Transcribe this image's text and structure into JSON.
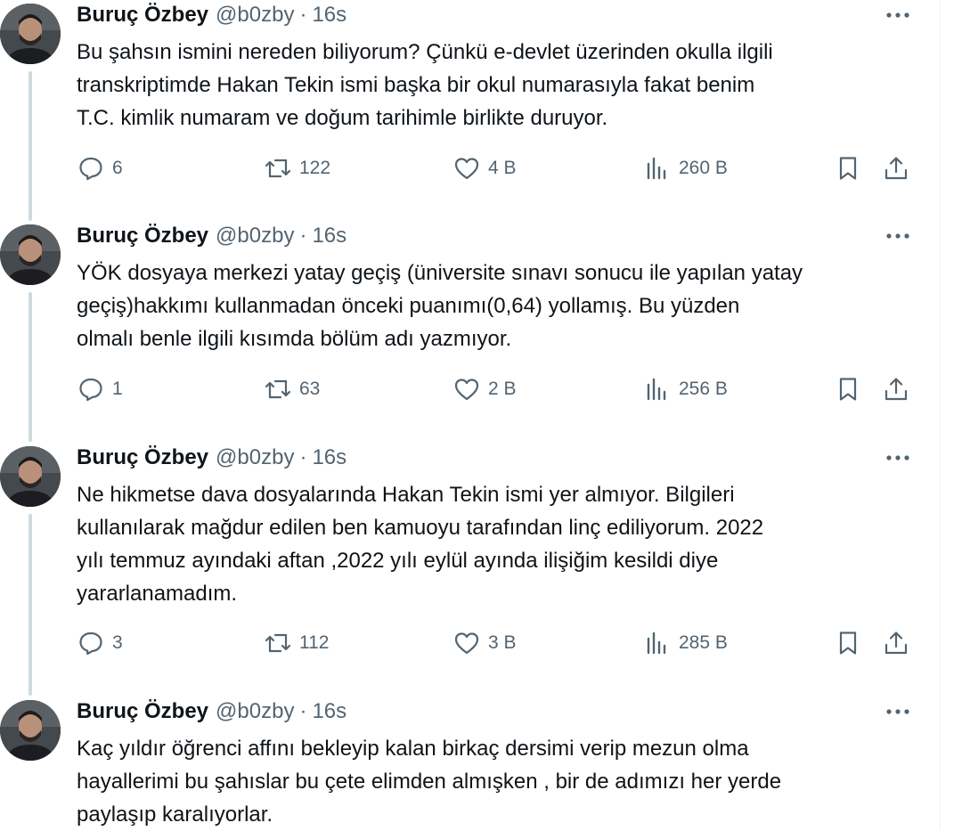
{
  "author": {
    "display_name": "Buruç Özbey",
    "handle": "@b0zby",
    "separator": "·",
    "time": "16s"
  },
  "icons": {
    "more": "more-horizontal-icon",
    "reply": "reply-icon",
    "retweet": "retweet-icon",
    "like": "heart-icon",
    "views": "views-icon",
    "bookmark": "bookmark-icon",
    "share": "share-icon"
  },
  "colors": {
    "text": "#0f1419",
    "secondary": "#536471",
    "thread_line": "#cfd9de"
  },
  "tweets": [
    {
      "text": "Bu şahsın ismini nereden biliyorum? Çünkü e-devlet üzerinden okulla ilgili\ntranskriptimde Hakan Tekin ismi başka bir okul numarasıyla fakat benim\nT.C. kimlik numaram ve doğum tarihimle birlikte duruyor.",
      "replies": "6",
      "retweets": "122",
      "likes": "4 B",
      "views": "260 B"
    },
    {
      "text": "YÖK dosyaya merkezi yatay geçiş  (üniversite sınavı sonucu ile yapılan yatay\ngeçiş)hakkımı kullanmadan önceki puanımı(0,64) yollamış. Bu yüzden\nolmalı benle ilgili kısımda bölüm adı yazmıyor.",
      "replies": "1",
      "retweets": "63",
      "likes": "2 B",
      "views": "256 B"
    },
    {
      "text": "Ne hikmetse dava dosyalarında Hakan Tekin ismi yer almıyor. Bilgileri\nkullanılarak mağdur edilen ben kamuoyu tarafından linç ediliyorum. 2022\nyılı temmuz ayındaki aftan ,2022 yılı eylül ayında ilişiğim kesildi diye\nyararlanamadım.",
      "replies": "3",
      "retweets": "112",
      "likes": "3 B",
      "views": "285 B"
    },
    {
      "text": "Kaç yıldır öğrenci affını bekleyip kalan birkaç dersimi verip mezun olma\nhayallerimi bu şahıslar bu çete elimden almışken , bir de adımızı her yerde\npaylaşıp karalıyorlar."
    }
  ]
}
